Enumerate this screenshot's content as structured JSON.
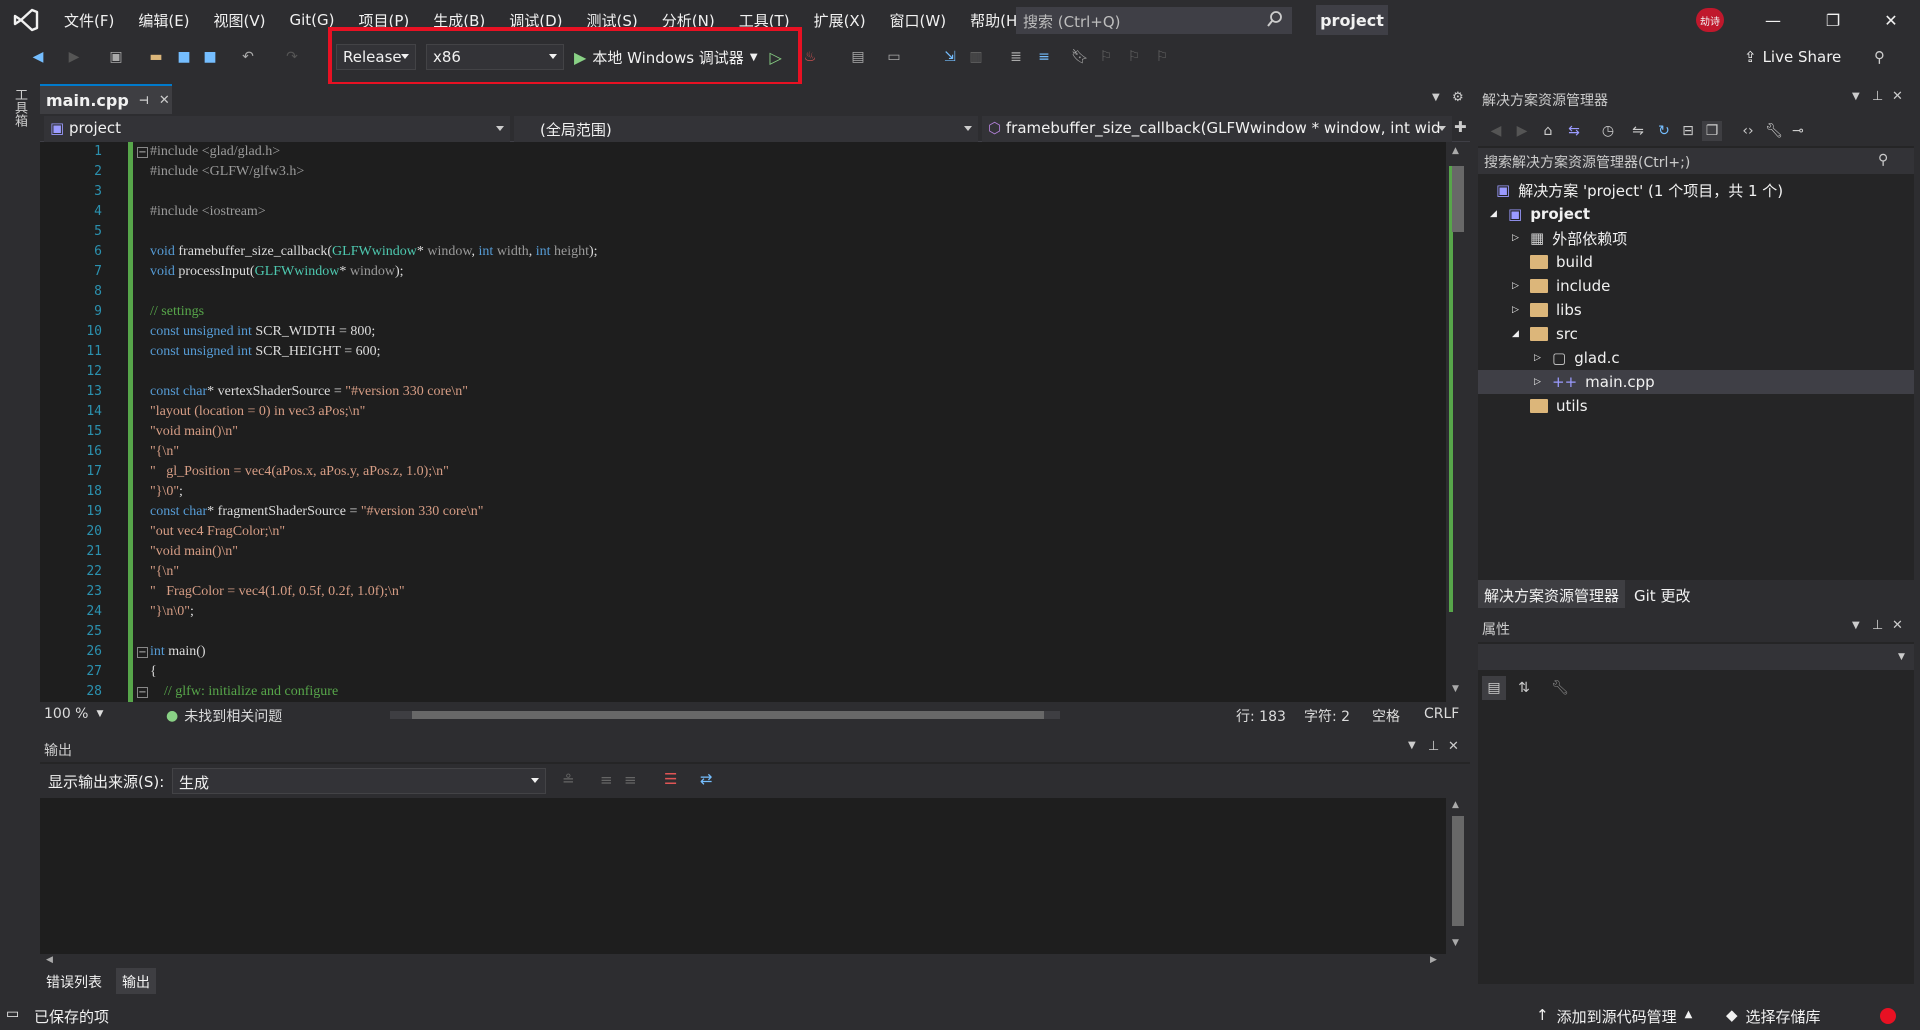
{
  "menu": [
    "文件(F)",
    "编辑(E)",
    "视图(V)",
    "Git(G)",
    "项目(P)",
    "生成(B)",
    "调试(D)",
    "测试(S)",
    "分析(N)",
    "工具(T)",
    "扩展(X)",
    "窗口(W)",
    "帮助(H)"
  ],
  "search": {
    "placeholder": "搜索 (Ctrl+Q)"
  },
  "project_title": "project",
  "avatar_text": "劫诗",
  "toolbar": {
    "config": "Release",
    "platform": "x86",
    "debugger": "本地 Windows 调试器",
    "live_share": "Live Share"
  },
  "left_toolstrip": "工具箱",
  "editor": {
    "tab": "main.cpp",
    "nav_project": "project",
    "nav_scope": "(全局范围)",
    "nav_member": "framebuffer_size_callback(GLFWwindow * window, int wid",
    "lines": [
      "1",
      "2",
      "3",
      "4",
      "5",
      "6",
      "7",
      "8",
      "9",
      "10",
      "11",
      "12",
      "13",
      "14",
      "15",
      "16",
      "17",
      "18",
      "19",
      "20",
      "21",
      "22",
      "23",
      "24",
      "25",
      "26",
      "27",
      "28"
    ],
    "zoom": "100 %",
    "issues": "未找到相关问题",
    "row": "行: 183",
    "col": "字符: 2",
    "space": "空格",
    "eol": "CRLF"
  },
  "output": {
    "title": "输出",
    "source_label": "显示输出来源(S):",
    "source_value": "生成"
  },
  "bottom_tabs": [
    "错误列表",
    "输出"
  ],
  "solution": {
    "title": "解决方案资源管理器",
    "search": "搜索解决方案资源管理器(Ctrl+;)",
    "solution_line": "解决方案 'project' (1 个项目，共 1 个)",
    "project": "project",
    "items": [
      "外部依赖项",
      "build",
      "include",
      "libs",
      "src",
      "glad.c",
      "main.cpp",
      "utils"
    ],
    "tabs": [
      "解决方案资源管理器",
      "Git 更改"
    ]
  },
  "properties": {
    "title": "属性"
  },
  "statusbar": {
    "saved": "已保存的项",
    "add_source": "添加到源代码管理",
    "select_repo": "选择存储库"
  },
  "colors": {
    "accent": "#007acc",
    "highlight": "#e81123",
    "green": "#57a64a"
  }
}
